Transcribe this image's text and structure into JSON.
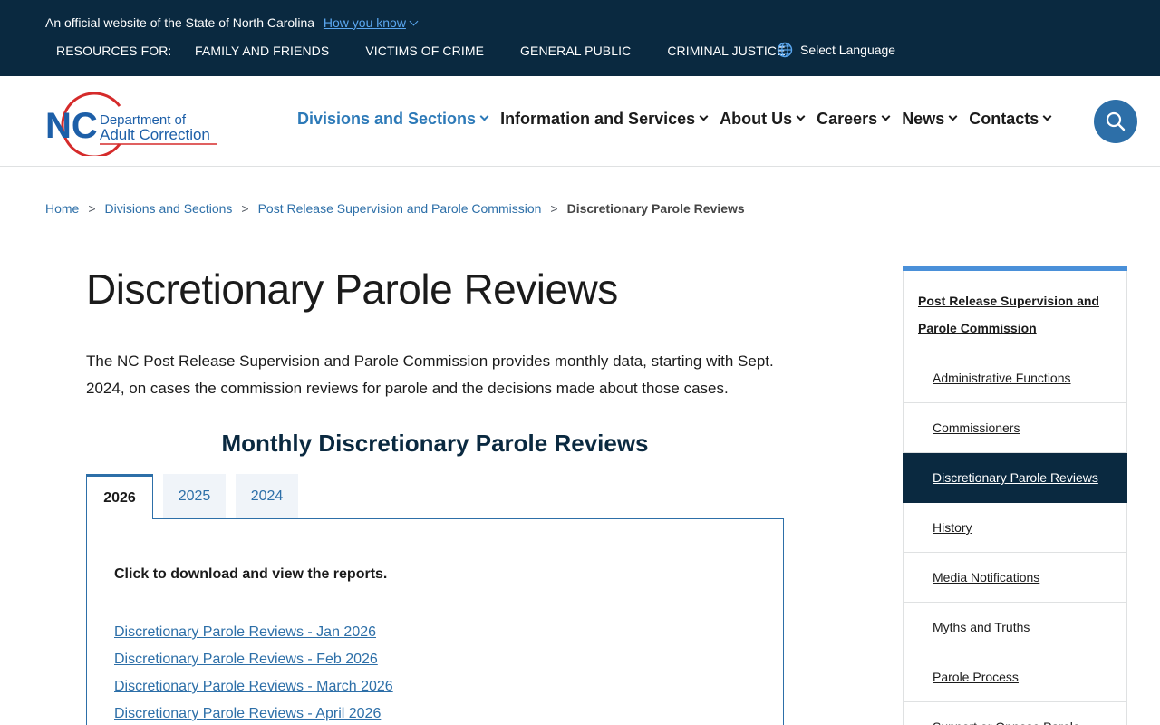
{
  "gov_banner": {
    "official_text": "An official website of the State of North Carolina",
    "how_you_know": "How you know",
    "resources_label": "RESOURCES FOR:",
    "resources": [
      "FAMILY AND FRIENDS",
      "VICTIMS OF CRIME",
      "GENERAL PUBLIC",
      "CRIMINAL JUSTICE"
    ],
    "language": "Select Language"
  },
  "header": {
    "logo": {
      "nc": "NC",
      "line1": "Department of",
      "line2": "Adult Correction"
    },
    "nav": [
      {
        "label": "Divisions and Sections"
      },
      {
        "label": "Information and Services"
      },
      {
        "label": "About Us"
      },
      {
        "label": "Careers"
      },
      {
        "label": "News"
      },
      {
        "label": "Contacts"
      }
    ]
  },
  "breadcrumb": {
    "items": [
      "Home",
      "Divisions and Sections",
      "Post Release Supervision and Parole Commission"
    ],
    "separator": ">",
    "current": "Discretionary Parole Reviews"
  },
  "main": {
    "title": "Discretionary Parole Reviews",
    "intro": "The NC Post Release Supervision and Parole Commission provides monthly data, starting with Sept. 2024, on cases the commission reviews for parole and the decisions made about those cases.",
    "section_heading": "Monthly Discretionary Parole Reviews",
    "tabs": [
      {
        "label": "2026"
      },
      {
        "label": "2025"
      },
      {
        "label": "2024"
      }
    ],
    "panel": {
      "instruction": "Click to download and view the reports.",
      "reports": [
        "Discretionary Parole Reviews - Jan 2026",
        "Discretionary Parole Reviews - Feb 2026",
        "Discretionary Parole Reviews - March 2026",
        "Discretionary Parole Reviews - April 2026"
      ]
    }
  },
  "sidebar": {
    "parent": "Post Release Supervision and Parole Commission",
    "items": [
      "Administrative Functions",
      "Commissioners",
      "Discretionary Parole Reviews",
      "History",
      "Media Notifications",
      "Myths and Truths",
      "Parole Process",
      "Support or Oppose Parole"
    ]
  },
  "colors": {
    "navy": "#0a2940",
    "link_blue": "#2d6fa8",
    "sidebar_accent": "#4a90d9",
    "logo_red": "#d52b2b"
  }
}
